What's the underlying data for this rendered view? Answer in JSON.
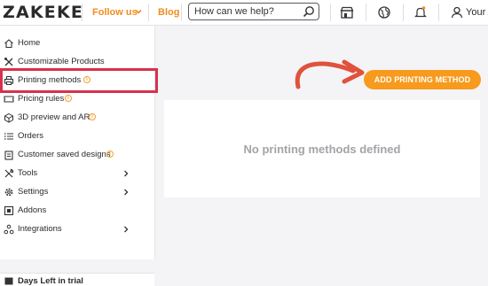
{
  "header": {
    "logo": "ZAKEKE",
    "follow_us": "Follow us",
    "blog": "Blog",
    "search_placeholder": "How can we help?",
    "user_label": "Your A"
  },
  "sidebar": {
    "items": [
      {
        "label": "Home",
        "icon": "home-icon"
      },
      {
        "label": "Customizable Products",
        "icon": "tools-icon"
      },
      {
        "label": "Printing methods",
        "icon": "printer-icon",
        "info": true
      },
      {
        "label": "Pricing rules",
        "icon": "ticket-icon",
        "info": true
      },
      {
        "label": "3D preview and AR",
        "icon": "cube-icon",
        "info": true
      },
      {
        "label": "Orders",
        "icon": "list-icon"
      },
      {
        "label": "Customer saved designs",
        "icon": "clipboard-icon",
        "info": true
      },
      {
        "label": "Tools",
        "icon": "wrench-icon",
        "chevron": true
      },
      {
        "label": "Settings",
        "icon": "gear-icon",
        "chevron": true
      },
      {
        "label": "Addons",
        "icon": "addon-icon"
      },
      {
        "label": "Integrations",
        "icon": "integrations-icon",
        "chevron": true
      }
    ],
    "footer_label": "Days Left in trial"
  },
  "main": {
    "add_button": "ADD PRINTING METHOD",
    "empty_message": "No printing methods defined"
  },
  "colors": {
    "accent": "#f79a1d",
    "highlight": "#d7324c",
    "arrow": "#e0523c"
  }
}
